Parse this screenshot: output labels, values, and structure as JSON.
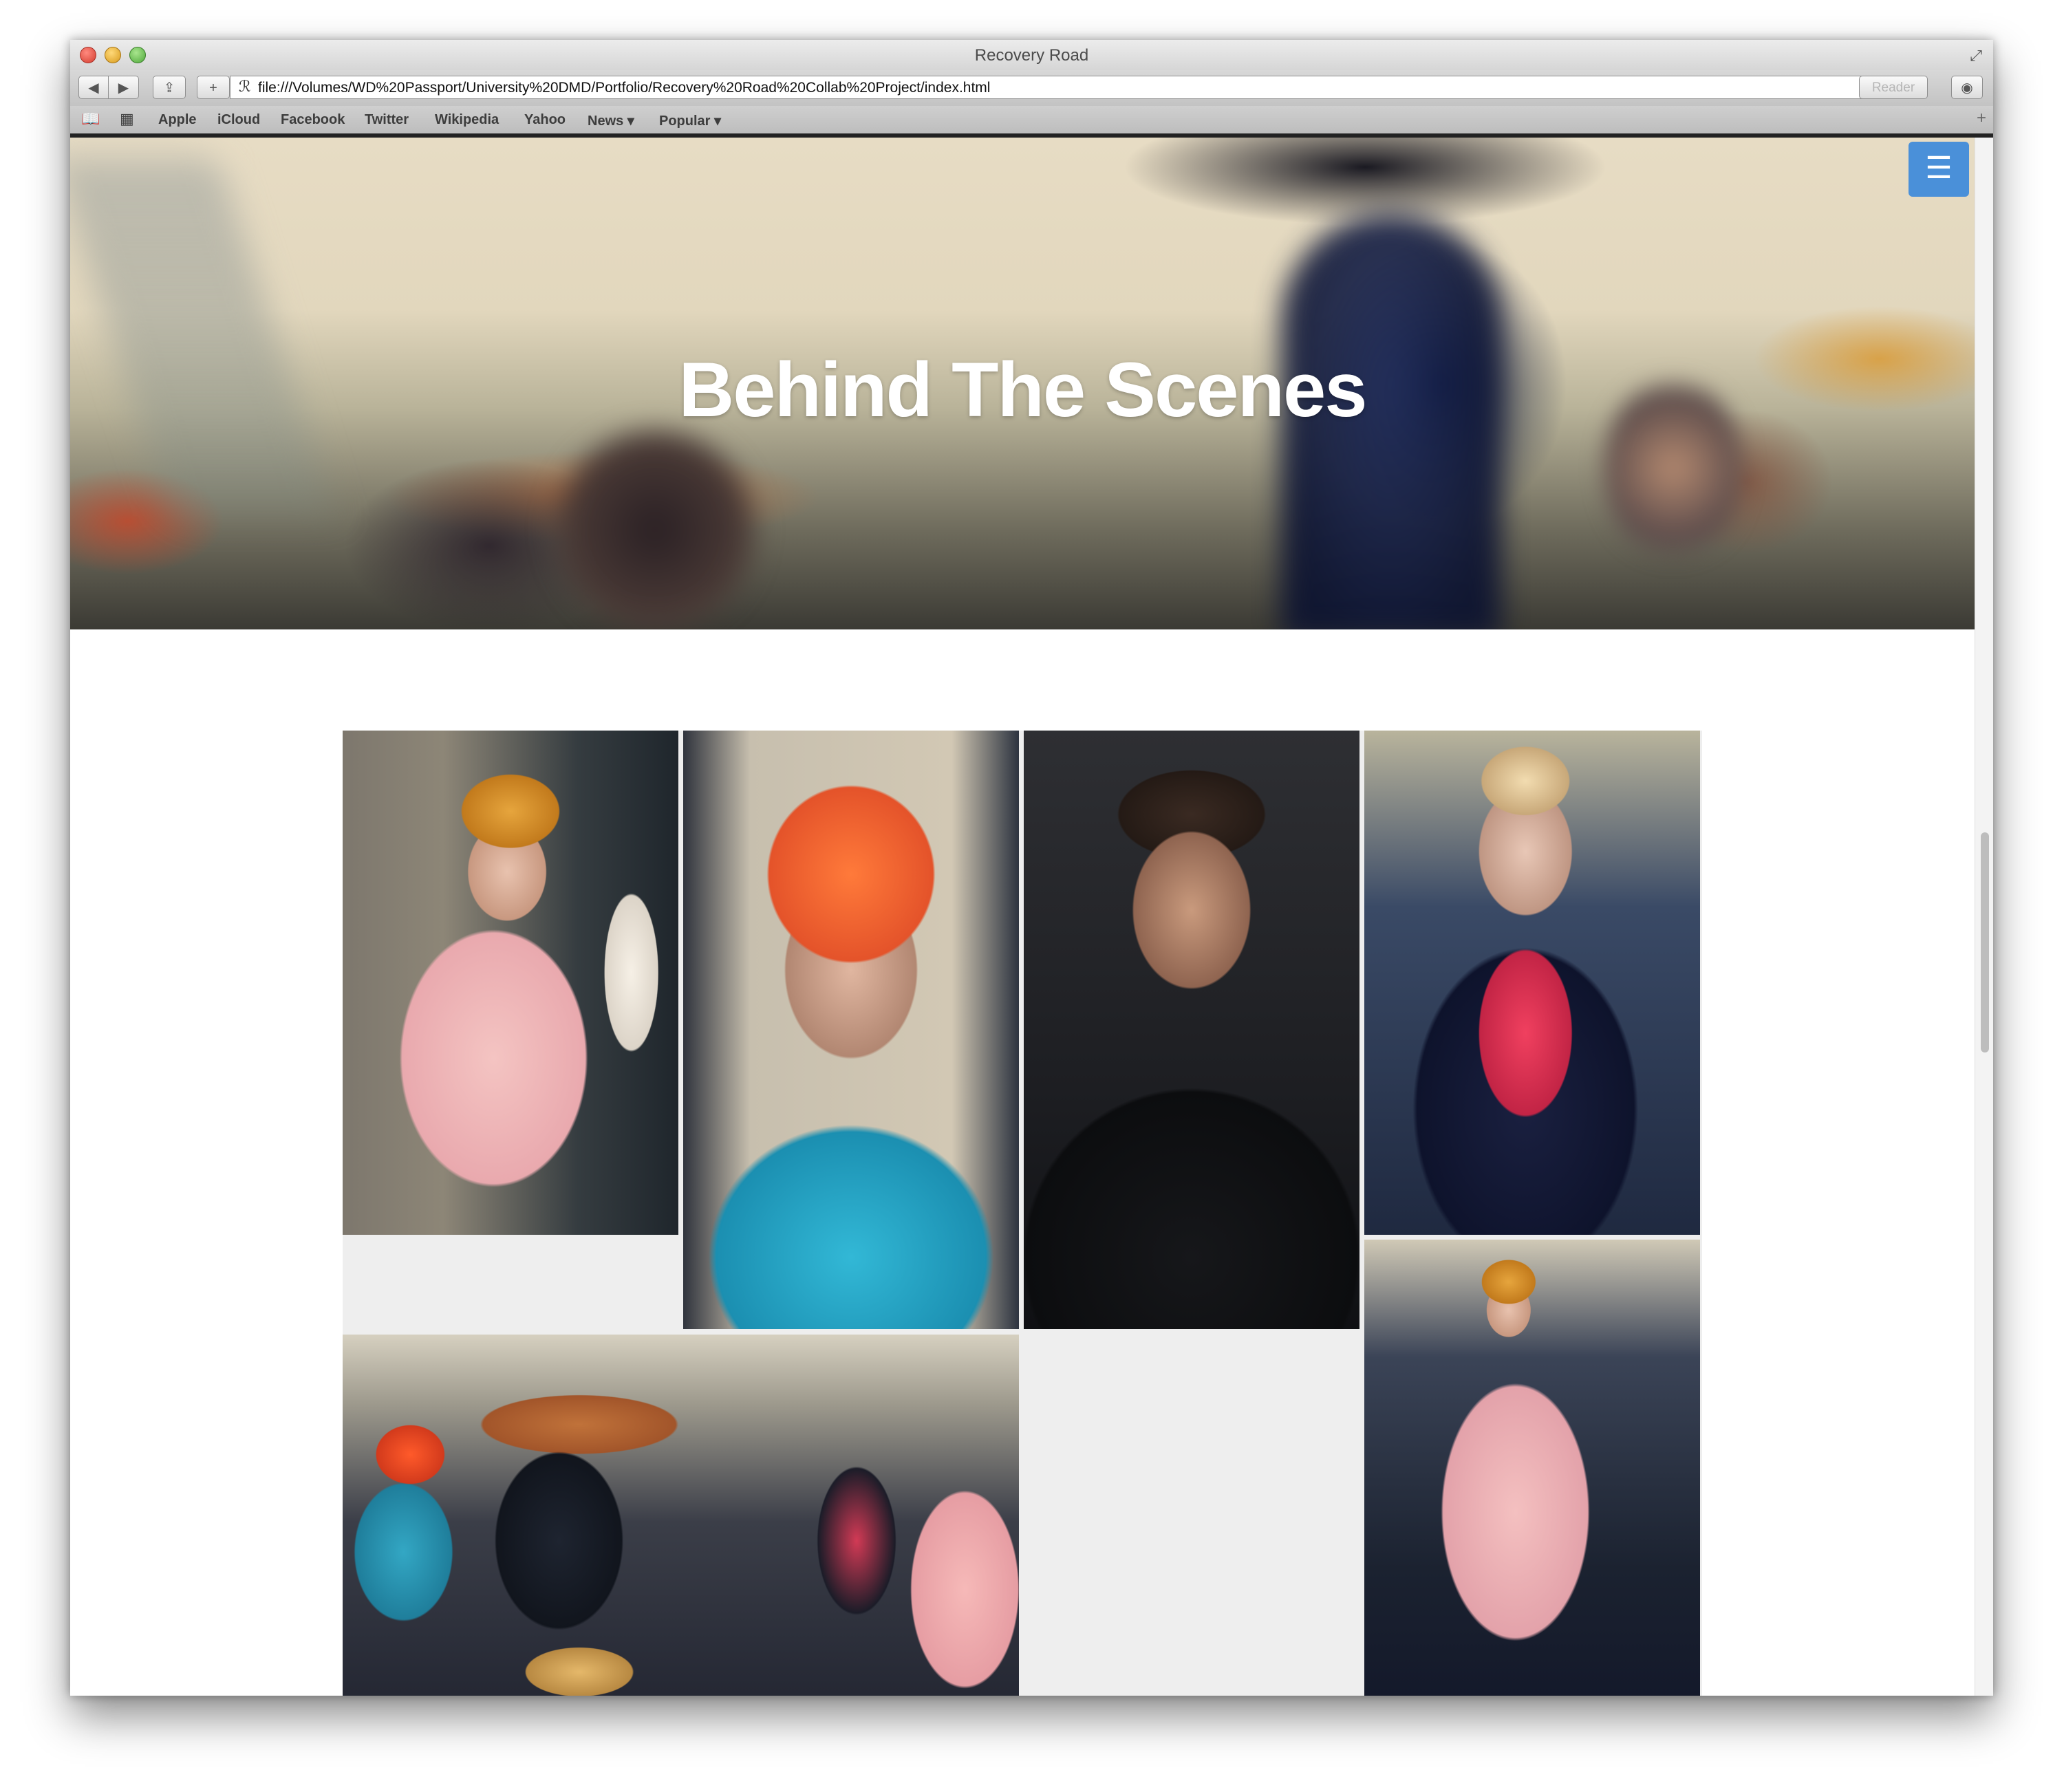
{
  "window": {
    "title": "Recovery Road"
  },
  "toolbar": {
    "url": "file:///Volumes/WD%20Passport/University%20DMD/Portfolio/Recovery%20Road%20Collab%20Project/index.html",
    "reader_label": "Reader",
    "back_glyph": "◀",
    "forward_glyph": "▶",
    "share_glyph": "⇪",
    "add_glyph": "+",
    "reload_glyph": "↻",
    "site_glyph": "ℛ",
    "download_glyph": "◉"
  },
  "bookmarks": {
    "items": [
      "Apple",
      "iCloud",
      "Facebook",
      "Twitter",
      "Wikipedia",
      "Yahoo",
      "News ▾",
      "Popular ▾"
    ],
    "book_glyph": "📖",
    "grid_glyph": "▦",
    "plus_glyph": "+"
  },
  "hero": {
    "title": "Behind The Scenes",
    "menu_glyph": "☰"
  },
  "gallery": {
    "photos": [
      "woman-in-orange-hat-pink-dress",
      "man-in-orange-beanie-blue-shirt",
      "bearded-man-black-jacket",
      "blonde-woman-glasses-red-blouse",
      "group-seated-around-table",
      "woman-seated-pink-dress"
    ]
  },
  "colors": {
    "menu_button": "#4a90d9",
    "gallery_bg": "#eeeeee"
  }
}
